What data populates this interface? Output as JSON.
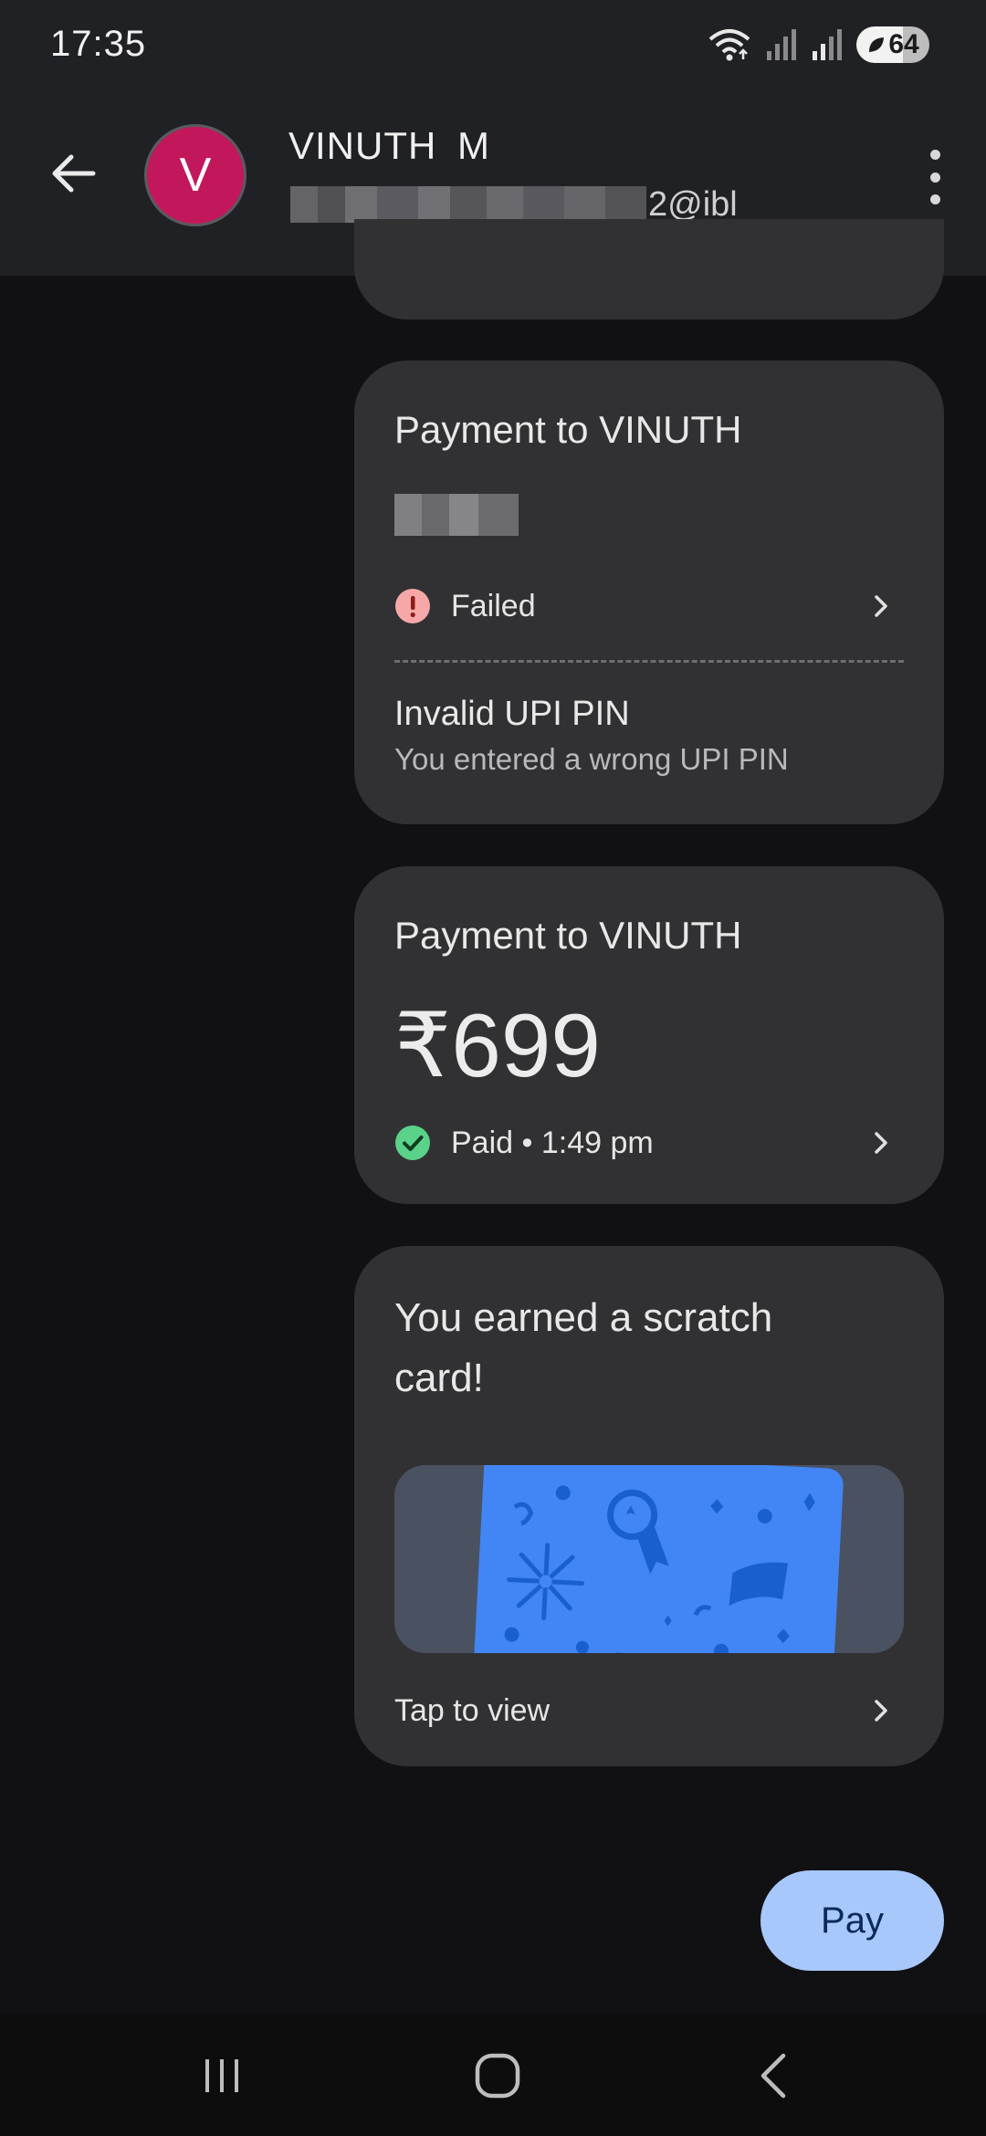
{
  "status_bar": {
    "time": "17:35",
    "battery": "64",
    "icons": [
      "wifi-icon",
      "signal-icon",
      "signal-icon",
      "battery-icon"
    ]
  },
  "header": {
    "avatar_letter": "V",
    "contact_name": "VINUTH  M",
    "upi_id_visible": "2@ibl",
    "avatar_color": "#c2185b"
  },
  "messages": [
    {
      "title": "Payment to VINUTH",
      "status": "Failed",
      "status_color": "#f6a8a8",
      "error_title": "Invalid UPI PIN",
      "error_detail": "You entered a wrong UPI PIN"
    },
    {
      "title": "Payment to VINUTH",
      "amount": "₹699",
      "status": "Paid • 1:49 pm",
      "status_color": "#5bd28a"
    },
    {
      "title": "You earned a scratch card!",
      "action": "Tap to view",
      "card_color": "#4285f4"
    }
  ],
  "pay_button": {
    "label": "Pay",
    "color": "#a8c7fa"
  },
  "nav_bar": {
    "icons": [
      "recent-apps-icon",
      "home-icon",
      "back-icon"
    ]
  }
}
